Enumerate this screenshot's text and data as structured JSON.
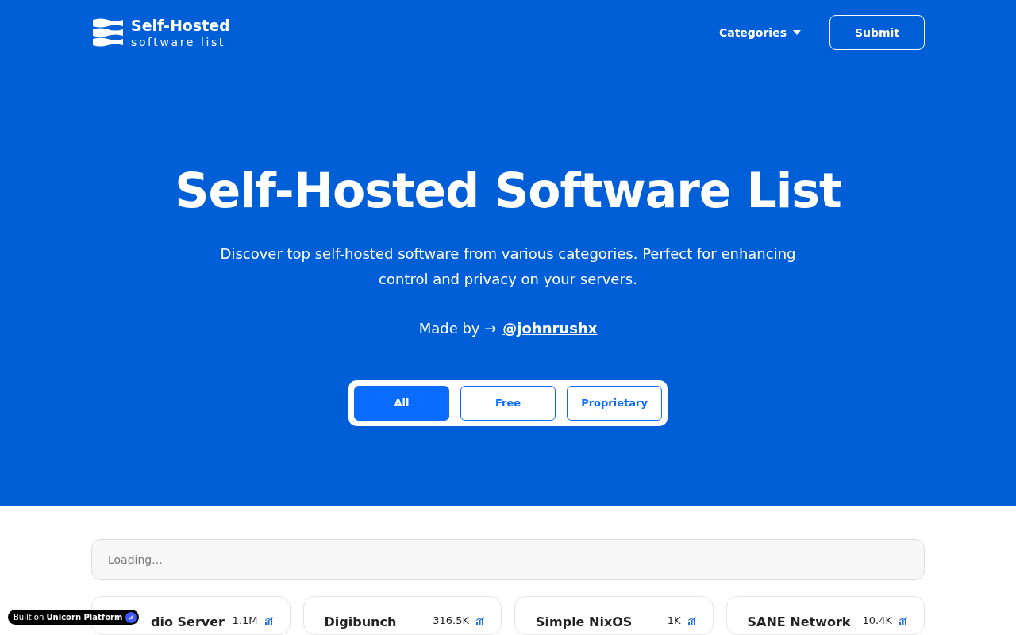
{
  "logo": {
    "title": "Self-Hosted",
    "subtitle": "software list"
  },
  "nav": {
    "categories": "Categories",
    "submit": "Submit"
  },
  "hero": {
    "title": "Self-Hosted Software List",
    "description": "Discover top self-hosted software from various categories. Perfect for enhancing control and privacy on your servers.",
    "made_by": "Made by →",
    "author": "@johnrushx"
  },
  "filters": [
    {
      "label": "All",
      "selected": true
    },
    {
      "label": "Free",
      "selected": false
    },
    {
      "label": "Proprietary",
      "selected": false
    }
  ],
  "search": {
    "placeholder": "Loading..."
  },
  "cards": [
    {
      "title": "dio Server",
      "count": "1.1M"
    },
    {
      "title": "Digibunch",
      "count": "316.5K"
    },
    {
      "title": "Simple NixOS",
      "count": "1K"
    },
    {
      "title": "SANE Network",
      "count": "10.4K"
    }
  ],
  "badge": {
    "prefix": "Built on",
    "brand": "Unicorn Platform"
  }
}
